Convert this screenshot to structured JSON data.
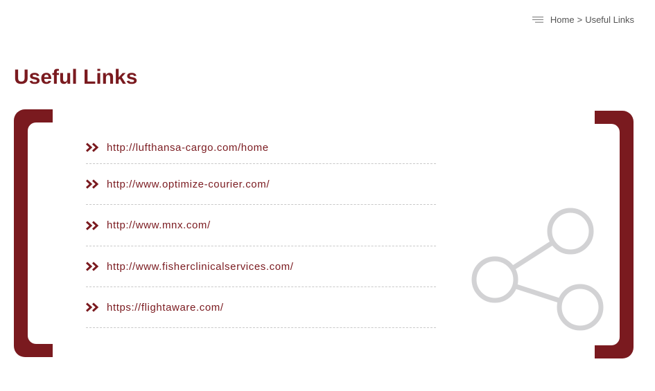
{
  "breadcrumb": {
    "icon": "menu-lines-icon",
    "home_label": "Home",
    "separator": ">",
    "current_label": "Useful Links"
  },
  "page": {
    "title": "Useful Links"
  },
  "links": [
    {
      "icon": "double-chevron-right-icon",
      "label": "http://lufthansa-cargo.com/home"
    },
    {
      "icon": "double-chevron-right-icon",
      "label": "http://www.optimize-courier.com/"
    },
    {
      "icon": "double-chevron-right-icon",
      "label": "http://www.mnx.com/"
    },
    {
      "icon": "double-chevron-right-icon",
      "label": "http://www.fisherclinicalservices.com/"
    },
    {
      "icon": "double-chevron-right-icon",
      "label": "https://flightaware.com/"
    }
  ],
  "decoration": {
    "icon": "share-icon"
  },
  "colors": {
    "brand": "#7a1a1f",
    "text": "#555555",
    "divider": "#c8c8c8",
    "share_graphic": "#d2d2d4"
  }
}
